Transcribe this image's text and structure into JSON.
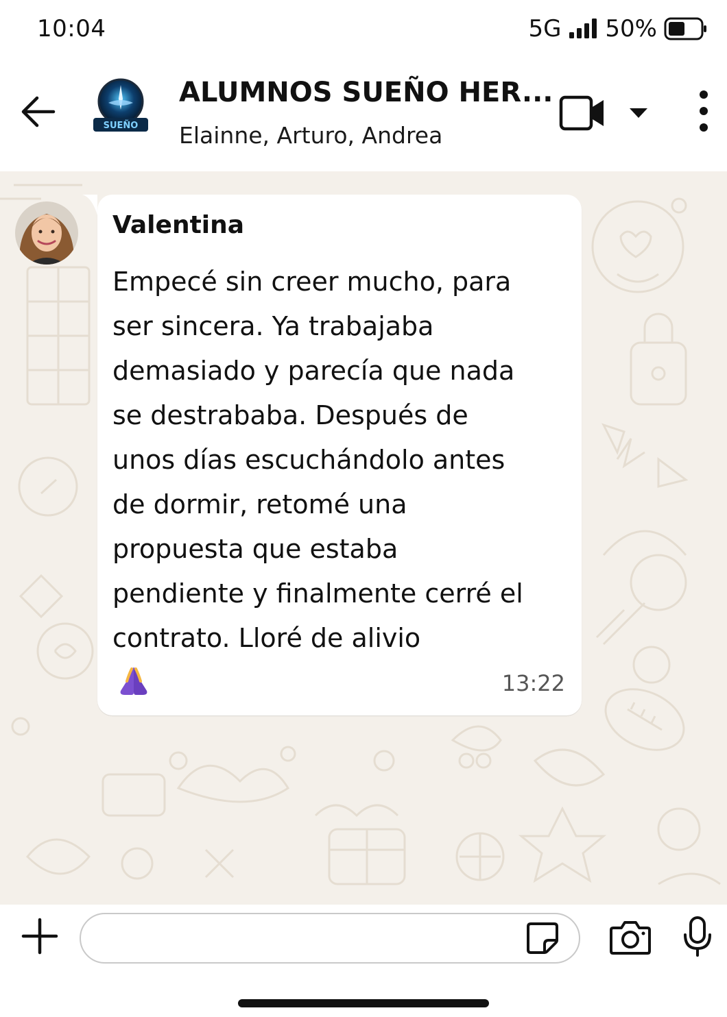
{
  "status_bar": {
    "time": "10:04",
    "network": "5G",
    "battery": "50%"
  },
  "header": {
    "title": "ALUMNOS SUEÑO HER...",
    "members": "Elainne, Arturo, Andrea",
    "avatar_text": "SUEÑO"
  },
  "message": {
    "sender": "Valentina",
    "text": "Empecé sin creer mucho, para\nser sincera. Ya trabajaba\ndemasiado y parecía que nada\nse destrababa. Después de\nunos días escuchándolo antes\nde dormir, retomé una\npropuesta que estaba\npendiente y finalmente cerré el\ncontrato. Lloré de alivio",
    "emoji": "🙏",
    "time": "13:22"
  },
  "input": {
    "placeholder": ""
  },
  "colors": {
    "wallpaper": "#f4f0ea",
    "doodle": "#e6ded3",
    "bubble": "#ffffff",
    "bars": "#ffffff",
    "emoji_purple": "#7b4fd0"
  },
  "icons": [
    "back-arrow-icon",
    "video-call-icon",
    "chevron-down-icon",
    "more-vertical-icon",
    "plus-icon",
    "sticker-icon",
    "camera-icon",
    "mic-icon",
    "signal-icon",
    "battery-icon"
  ]
}
